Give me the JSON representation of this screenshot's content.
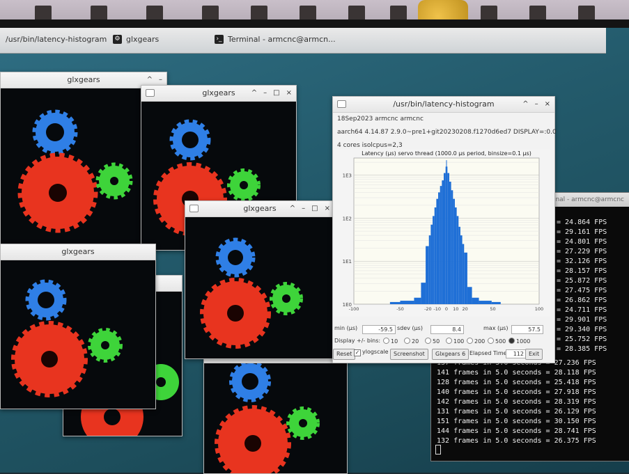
{
  "taskbar": {
    "items": [
      {
        "label": "/usr/bin/latency-histogram"
      },
      {
        "label": "glxgears"
      },
      {
        "label": "Terminal - armcnc@armcn..."
      }
    ]
  },
  "glx_windows": [
    {
      "title": "glxgears"
    },
    {
      "title": "glxgears"
    },
    {
      "title": "glxgears"
    },
    {
      "title": "glxgears"
    },
    {
      "title": "glxgears"
    },
    {
      "title": "glxgears"
    }
  ],
  "window_controls": {
    "minimize": "–",
    "maximize": "□",
    "close": "×",
    "shade": "^"
  },
  "colors": {
    "gear_red": "#e8341f",
    "gear_green": "#3ed43a",
    "gear_blue": "#2f7fe6",
    "histogram": "#1f6fd6"
  },
  "latency": {
    "title": "/usr/bin/latency-histogram",
    "info1": "18Sep2023 armcnc armcnc",
    "info2": "aarch64  4.14.87  2.9.0~pre1+git20230208.f1270d6ed7  DISPLAY=:0.0",
    "info3": "4 cores  isolcpus=2,3",
    "chart_title": "Latency (µs) servo thread (1000.0 µs period, binsize=0.1 µs)",
    "min_label": "min (µs)",
    "min_value": "-59.5",
    "sdev_label": "sdev (µs)",
    "sdev_value": "8.4",
    "max_label": "max (µs)",
    "max_value": "57.5",
    "bins_label": "Display +/- bins:",
    "bins": [
      "10",
      "20",
      "50",
      "100",
      "200",
      "500",
      "1000"
    ],
    "selected_bin": "1000",
    "reset_label": "Reset",
    "ylog_label": "ylogscale",
    "screenshot_label": "Screenshot",
    "glx_label": "Glxgears",
    "glx_count": "6",
    "elapsed_label": "Elapsed Time:",
    "elapsed_value": "112",
    "exit_label": "Exit"
  },
  "chart_data": {
    "type": "bar",
    "title": "Latency (µs) servo thread (1000.0 µs period, binsize=0.1 µs)",
    "x_tick_labels": [
      "-100",
      "-50",
      "-20",
      "-10",
      "0",
      "10",
      "20",
      "50",
      "100"
    ],
    "y_tick_labels": [
      "1E0",
      "1E1",
      "1E2",
      "1E3"
    ],
    "xlim": [
      -100,
      100
    ],
    "ylim_log10": [
      0,
      3.4
    ],
    "y_scale": "log",
    "grid": true,
    "legend": "none",
    "x": [
      -60,
      -40,
      -30,
      -25,
      -20,
      -18,
      -16,
      -14,
      -12,
      -10,
      -8,
      -6,
      -4,
      -2,
      0,
      2,
      4,
      6,
      8,
      10,
      12,
      14,
      16,
      18,
      20,
      25,
      30,
      40,
      57.5
    ],
    "values_log10": [
      0.05,
      0.08,
      0.15,
      0.5,
      1.35,
      1.6,
      1.85,
      2.05,
      2.25,
      2.45,
      2.6,
      2.75,
      2.88,
      3.05,
      3.2,
      3.05,
      2.85,
      2.65,
      2.45,
      2.25,
      2.05,
      1.8,
      1.6,
      1.4,
      1.2,
      0.4,
      0.15,
      0.08,
      0.05
    ]
  },
  "terminal": {
    "title": "Terminal - armcnc@armcnc",
    "fps_values": [
      "= 24.864 FPS",
      "= 29.161 FPS",
      "= 24.801 FPS",
      "= 27.229 FPS",
      "= 32.126 FPS",
      "= 28.157 FPS",
      "= 25.872 FPS",
      "= 27.475 FPS",
      "= 26.862 FPS",
      "= 24.711 FPS",
      "= 29.901 FPS",
      "= 29.340 FPS",
      "= 25.752 FPS",
      "= 28.385 FPS"
    ],
    "lines": [
      "137 frames in 5.0 seconds = 27.236 FPS",
      "141 frames in 5.0 seconds = 28.118 FPS",
      "128 frames in 5.0 seconds = 25.418 FPS",
      "140 frames in 5.0 seconds = 27.918 FPS",
      "142 frames in 5.0 seconds = 28.319 FPS",
      "131 frames in 5.0 seconds = 26.129 FPS",
      "151 frames in 5.0 seconds = 30.150 FPS",
      "144 frames in 5.0 seconds = 28.741 FPS",
      "132 frames in 5.0 seconds = 26.375 FPS"
    ]
  }
}
